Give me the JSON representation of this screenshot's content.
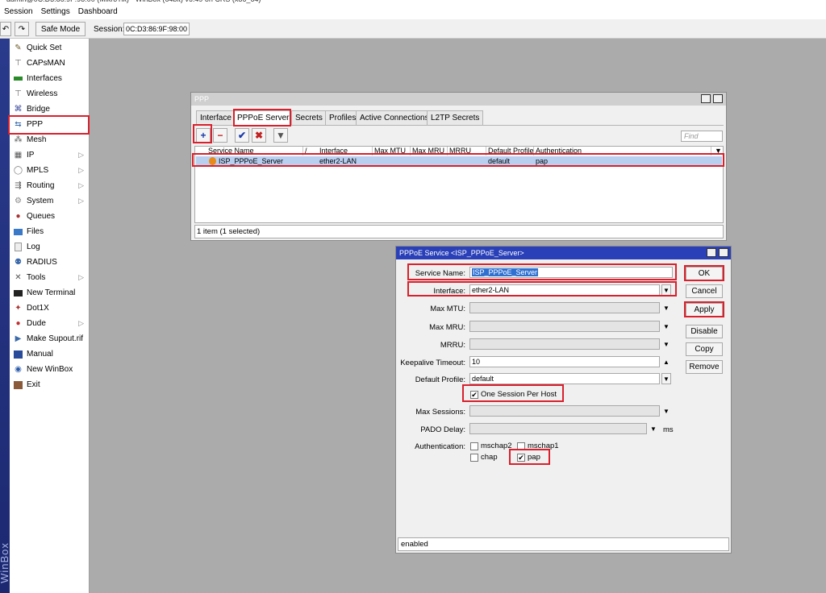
{
  "menubar": {
    "items": [
      "Session",
      "Settings",
      "Dashboard"
    ]
  },
  "toolbar": {
    "safe_mode": "Safe Mode",
    "session_label": "Session:",
    "session_value": "0C:D3:86:9F:98:00"
  },
  "brand": "WinBox",
  "sidebar": {
    "items": [
      {
        "label": "Quick Set",
        "icon": "wand-icon"
      },
      {
        "label": "CAPsMAN",
        "icon": "antenna-icon"
      },
      {
        "label": "Interfaces",
        "icon": "interfaces-icon"
      },
      {
        "label": "Wireless",
        "icon": "wireless-icon"
      },
      {
        "label": "Bridge",
        "icon": "bridge-icon"
      },
      {
        "label": "PPP",
        "icon": "ppp-icon"
      },
      {
        "label": "Mesh",
        "icon": "mesh-icon"
      },
      {
        "label": "IP",
        "icon": "ip-icon",
        "submenu": true
      },
      {
        "label": "MPLS",
        "icon": "mpls-icon",
        "submenu": true
      },
      {
        "label": "Routing",
        "icon": "routing-icon",
        "submenu": true
      },
      {
        "label": "System",
        "icon": "system-icon",
        "submenu": true
      },
      {
        "label": "Queues",
        "icon": "queues-icon"
      },
      {
        "label": "Files",
        "icon": "folder-icon"
      },
      {
        "label": "Log",
        "icon": "log-icon"
      },
      {
        "label": "RADIUS",
        "icon": "radius-icon"
      },
      {
        "label": "Tools",
        "icon": "tools-icon",
        "submenu": true
      },
      {
        "label": "New Terminal",
        "icon": "terminal-icon"
      },
      {
        "label": "Dot1X",
        "icon": "dot1x-icon"
      },
      {
        "label": "Dude",
        "icon": "dude-icon",
        "submenu": true
      },
      {
        "label": "Make Supout.rif",
        "icon": "supout-icon"
      },
      {
        "label": "Manual",
        "icon": "manual-icon"
      },
      {
        "label": "New WinBox",
        "icon": "winbox-icon"
      },
      {
        "label": "Exit",
        "icon": "exit-icon"
      }
    ]
  },
  "ppp_window": {
    "title": "PPP",
    "tabs": [
      "Interface",
      "PPPoE Servers",
      "Secrets",
      "Profiles",
      "Active Connections",
      "L2TP Secrets"
    ],
    "find_placeholder": "Find",
    "columns": [
      "Service Name",
      "/",
      "Interface",
      "Max MTU",
      "Max MRU",
      "MRRU",
      "Default Profile",
      "Authentication"
    ],
    "rows": [
      {
        "service_name": "ISP_PPPoE_Server",
        "interface": "ether2-LAN",
        "max_mtu": "",
        "max_mru": "",
        "mrru": "",
        "default_profile": "default",
        "authentication": "pap"
      }
    ],
    "status": "1 item (1 selected)"
  },
  "service_dialog": {
    "title": "PPPoE Service <ISP_PPPoE_Server>",
    "labels": {
      "service_name": "Service Name:",
      "interface": "Interface:",
      "max_mtu": "Max MTU:",
      "max_mru": "Max MRU:",
      "mrru": "MRRU:",
      "keepalive": "Keepalive Timeout:",
      "default_profile": "Default Profile:",
      "one_session": "One Session Per Host",
      "max_sessions": "Max Sessions:",
      "pado_delay": "PADO Delay:",
      "pado_unit": "ms",
      "authentication": "Authentication:"
    },
    "values": {
      "service_name": "ISP_PPPoE_Server",
      "interface": "ether2-LAN",
      "max_mtu": "",
      "max_mru": "",
      "mrru": "",
      "keepalive": "10",
      "default_profile": "default",
      "max_sessions": "",
      "pado_delay": ""
    },
    "auth": {
      "mschap2": "mschap2",
      "mschap1": "mschap1",
      "chap": "chap",
      "pap": "pap"
    },
    "buttons": {
      "ok": "OK",
      "cancel": "Cancel",
      "apply": "Apply",
      "disable": "Disable",
      "copy": "Copy",
      "remove": "Remove"
    },
    "status": "enabled"
  }
}
